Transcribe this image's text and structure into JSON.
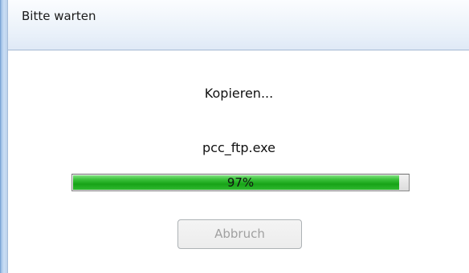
{
  "window": {
    "title": "Bitte warten"
  },
  "dialog": {
    "status": "Kopieren...",
    "file_name": "pcc_ftp.exe",
    "progress": {
      "value": 97,
      "label": "97%"
    },
    "cancel_label": "Abbruch",
    "cancel_enabled": false
  },
  "colors": {
    "progress_fill": "#17a317",
    "title_bar": "#e6eff9",
    "disabled_text": "#a0a0a0"
  }
}
